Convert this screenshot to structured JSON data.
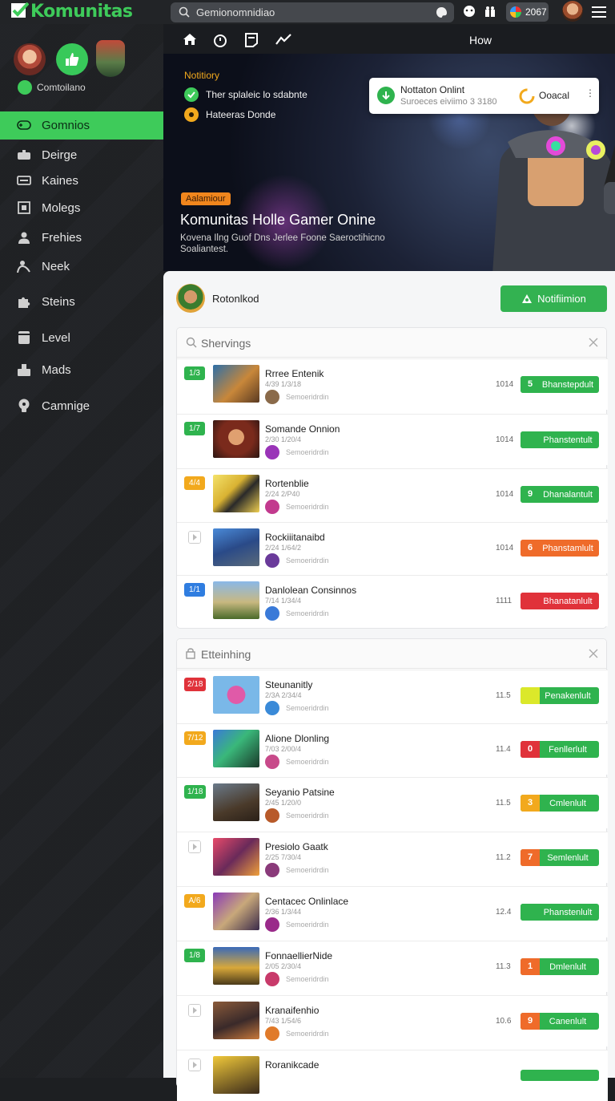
{
  "app": {
    "logo": "Komunitas"
  },
  "topbar": {
    "search_placeholder": "Gemionomnidiao",
    "coins": "2067"
  },
  "sidebar": {
    "status": "Comtoilano",
    "items": [
      {
        "label": "Gomnios",
        "icon": "gamepad-icon",
        "active": true
      },
      {
        "label": "Deirge",
        "icon": "controller-icon"
      },
      {
        "label": "Kaines",
        "icon": "card-icon"
      },
      {
        "label": "Molegs",
        "icon": "grid-icon"
      },
      {
        "label": "Frehies",
        "icon": "user-icon"
      },
      {
        "label": "Neek",
        "icon": "person-icon"
      },
      {
        "label": "Steins",
        "icon": "puzzle-icon"
      },
      {
        "label": "Level",
        "icon": "document-icon"
      },
      {
        "label": "Mads",
        "icon": "chart-icon"
      },
      {
        "label": "Camnige",
        "icon": "bulb-icon"
      }
    ]
  },
  "subnav": {
    "how": "How"
  },
  "hero": {
    "label": "Notitiory",
    "row1": "Ther splaleic lo sdabnte",
    "row2": "Hateeras Donde",
    "badge": "Aalamiour",
    "title": "Komunitas Holle Gamer Onine",
    "desc": "Kovena Ilng Guof Dns Jerlee Foone Saeroctihicno Soaliantest."
  },
  "toast": {
    "title": "Nottaton Onlint",
    "subtitle": "Suroeces eiviimo 3 3180",
    "action": "Ooacal",
    "more": "⋮"
  },
  "profile": {
    "name": "Rotonlkod",
    "button": "Notifiimion"
  },
  "panels": [
    {
      "header": "Shervings",
      "rows": [
        {
          "badge": "1/3",
          "badge_color": "#2fb34e",
          "title": "Rrree Entenik",
          "sub": "4/39   1/3/18",
          "meta": "Semoeridrdin",
          "num": "1014",
          "btn_n": "5",
          "btn_label": "Bhanstepdult",
          "btn_color": "#2fb34e",
          "btn_n_color": "#2fb34e",
          "thumb": "linear-gradient(135deg,#2d6fa8,#c8873a 55%,#5a3a22)",
          "mini": "#8a6a4a"
        },
        {
          "badge": "1/7",
          "badge_color": "#2fb34e",
          "title": "Somande Onnion",
          "sub": "2/30   1/20/4",
          "meta": "Semoeridrdin",
          "num": "1014",
          "btn_n": "",
          "btn_label": "Phanstentult",
          "btn_color": "#2fb34e",
          "btn_n_color": "#2fb34e",
          "thumb": "radial-gradient(circle at 50% 45%,#e0a070 0 25%,#7a2a1c 26% 55%,#2a1612)",
          "mini": "#9a34b8"
        },
        {
          "badge": "4/4",
          "badge_color": "#f2a91d",
          "title": "Rortenblie",
          "sub": "2/24   2/P40",
          "meta": "Semoeridrdin",
          "num": "1014",
          "btn_n": "9",
          "btn_label": "Dhanalantult",
          "btn_color": "#2fb34e",
          "btn_n_color": "#2fb34e",
          "thumb": "linear-gradient(135deg,#f4e26a,#d9b232 40%,#2a2a2a 60%,#f0d050)",
          "mini": "#c23a8e"
        },
        {
          "badge": "",
          "badge_color": "",
          "title": "Rockiiitanaibd",
          "sub": "2/24   1/64/2",
          "meta": "Semoeridrdin",
          "num": "1014",
          "btn_n": "6",
          "btn_label": "Phanstamlult",
          "btn_color": "#ef6b2a",
          "btn_n_color": "#ef6b2a",
          "thumb": "linear-gradient(160deg,#4a8ad8,#2a4a88 50%,#5a6a7a)",
          "mini": "#6a3a9a"
        },
        {
          "badge": "1/1",
          "badge_color": "#2f7de0",
          "title": "Danlolean Consinnos",
          "sub": "7/14   1/34/4",
          "meta": "Semoeridrdin",
          "num": "1111",
          "btn_n": "",
          "btn_label": "Bhanatanlult",
          "btn_color": "#e0323a",
          "btn_n_color": "#e0323a",
          "thumb": "linear-gradient(180deg,#8ab8e8,#c8b880 55%,#4a6a2a)",
          "mini": "#3a7ad8"
        }
      ]
    },
    {
      "header": "Etteinhing",
      "rows": [
        {
          "badge": "2/18",
          "badge_color": "#e0323a",
          "title": "Steunanitly",
          "sub": "2/3A   2/34/4",
          "meta": "Semoeridrdin",
          "num": "11.5",
          "btn_n": "",
          "btn_label": "Penakenlult",
          "btn_color": "#2fb34e",
          "btn_n_color": "#dbe82a",
          "thumb": "radial-gradient(circle at 50% 50%,#e05aa8 0 30%,#7ab8e8 31%)",
          "mini": "#3a8ad8"
        },
        {
          "badge": "7/12",
          "badge_color": "#f2a91d",
          "title": "Alione Dlonling",
          "sub": "7/03   2/00/4",
          "meta": "Semoeridrdin",
          "num": "11.4",
          "btn_n": "0",
          "btn_label": "Fenllerlult",
          "btn_color": "#2fb34e",
          "btn_n_color": "#e0323a",
          "thumb": "linear-gradient(135deg,#3a7ad8,#3ab87a 45%,#1a3a2a)",
          "mini": "#c84a8a"
        },
        {
          "badge": "1/18",
          "badge_color": "#2fb34e",
          "title": "Seyanio Patsine",
          "sub": "2/45   1/20/0",
          "meta": "Semoeridrdin",
          "num": "11.5",
          "btn_n": "3",
          "btn_label": "Cmlenlult",
          "btn_color": "#2fb34e",
          "btn_n_color": "#f2a91d",
          "thumb": "linear-gradient(160deg,#6a7a8a,#4a3a2a 60%,#2a2018)",
          "mini": "#b85a2a"
        },
        {
          "badge": "",
          "badge_color": "",
          "title": "Presiolo Gaatk",
          "sub": "2/25   7/30/4",
          "meta": "Semoeridrdin",
          "num": "11.2",
          "btn_n": "7",
          "btn_label": "Semlenlult",
          "btn_color": "#2fb34e",
          "btn_n_color": "#ef6b2a",
          "thumb": "linear-gradient(135deg,#e84a6a,#6a2a5a 50%,#f0a03a)",
          "mini": "#8a3a7a"
        },
        {
          "badge": "A/6",
          "badge_color": "#f2a91d",
          "title": "Centacec Onlinlace",
          "sub": "2/36   1/3/44",
          "meta": "Semoeridrdin",
          "num": "12.4",
          "btn_n": "",
          "btn_label": "Phanstenlult",
          "btn_color": "#2fb34e",
          "btn_n_color": "#2fb34e",
          "thumb": "linear-gradient(135deg,#8a3ab8,#c8a87a 50%,#3a2a4a)",
          "mini": "#9a2a8a"
        },
        {
          "badge": "1/8",
          "badge_color": "#2fb34e",
          "title": "FonnaellierNide",
          "sub": "2/05   2/30/4",
          "meta": "Semoeridrdin",
          "num": "11.3",
          "btn_n": "1",
          "btn_label": "Dmlenlult",
          "btn_color": "#2fb34e",
          "btn_n_color": "#ef6b2a",
          "thumb": "linear-gradient(180deg,#3a6ab8,#d8a83a 55%,#4a3a1a)",
          "mini": "#c83a6a"
        },
        {
          "badge": "",
          "badge_color": "",
          "title": "Kranaifenhio",
          "sub": "7/43   1/54/6",
          "meta": "Semoeridrdin",
          "num": "10.6",
          "btn_n": "9",
          "btn_label": "Canenlult",
          "btn_color": "#2fb34e",
          "btn_n_color": "#ef6b2a",
          "thumb": "linear-gradient(160deg,#8a5a3a,#3a2a2a 55%,#c8783a)",
          "mini": "#e07a2a"
        },
        {
          "badge": "",
          "badge_color": "",
          "title": "Roranikcade",
          "sub": "",
          "meta": "",
          "num": "",
          "btn_n": "",
          "btn_label": "",
          "btn_color": "#2fb34e",
          "btn_n_color": "#ef6b2a",
          "thumb": "linear-gradient(160deg,#f0c83a,#3a2a1a)",
          "mini": "#2a2a2a"
        }
      ]
    }
  ]
}
